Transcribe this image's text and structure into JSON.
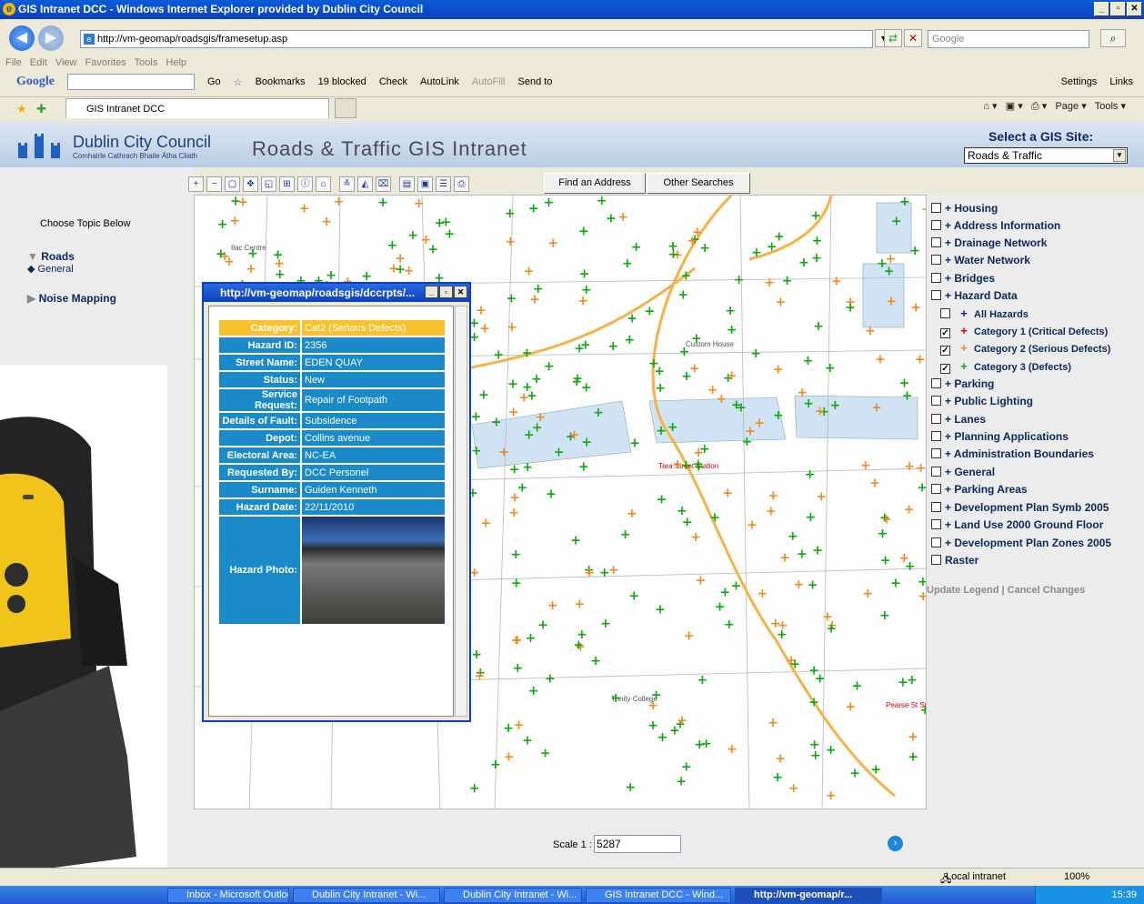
{
  "window": {
    "title": "GIS Intranet DCC - Windows Internet Explorer provided by Dublin City Council",
    "url": "http://vm-geomap/roadsgis/framesetup.asp",
    "search_placeholder": "Google"
  },
  "menu": [
    "File",
    "Edit",
    "View",
    "Favorites",
    "Tools",
    "Help"
  ],
  "google_toolbar": {
    "logo": "Google",
    "go": "Go",
    "bookmarks": "Bookmarks",
    "blocked": "19 blocked",
    "check": "Check",
    "autolink": "AutoLink",
    "autofill": "AutoFill",
    "sendto": "Send to",
    "settings": "Settings",
    "links": "Links"
  },
  "tabs": {
    "active": "GIS Intranet DCC"
  },
  "command_bar": {
    "page": "Page",
    "tools": "Tools"
  },
  "header": {
    "org_name": "Dublin City Council",
    "org_sub": "Comhairle Cathrach Bhaile Átha Cliath",
    "app_title": "Roads & Traffic GIS Intranet",
    "site_label": "Select a GIS Site:",
    "site_value": "Roads & Traffic"
  },
  "toolbar": {
    "find_address": "Find an Address",
    "other_searches": "Other Searches"
  },
  "left": {
    "choose": "Choose Topic Below",
    "roads": "Roads",
    "general": "General",
    "noise": "Noise Mapping"
  },
  "map": {
    "labels": [
      "Ilac Centre",
      "Custom House",
      "Tara Street Station",
      "Trinity College",
      "Pearse St Station"
    ]
  },
  "scale": {
    "label": "Scale 1 :",
    "value": "5287"
  },
  "popup": {
    "title": "http://vm-geomap/roadsgis/dccrpts/...",
    "rows": [
      {
        "k": "Category:",
        "v": "Cat2 (Serious Defects)"
      },
      {
        "k": "Hazard ID:",
        "v": "2356"
      },
      {
        "k": "Street Name:",
        "v": "EDEN QUAY"
      },
      {
        "k": "Status:",
        "v": "New"
      },
      {
        "k": "Service Request:",
        "v": "Repair of Footpath"
      },
      {
        "k": "Details of Fault:",
        "v": "Subsidence"
      },
      {
        "k": "Depot:",
        "v": "Collins avenue"
      },
      {
        "k": "Electoral Area:",
        "v": "NC-EA"
      },
      {
        "k": "Requested By:",
        "v": "DCC Personel"
      },
      {
        "k": "Surname:",
        "v": "Guiden Kenneth"
      },
      {
        "k": "Hazard Date:",
        "v": "22/11/2010"
      }
    ],
    "photo_label": "Hazard Photo:"
  },
  "legend": {
    "items": [
      "+ Housing",
      "+ Address Information",
      "+ Drainage Network",
      "+ Water Network",
      "+ Bridges",
      "+ Hazard Data"
    ],
    "hazards": [
      "All Hazards",
      "Category 1 (Critical Defects)",
      "Category 2 (Serious Defects)",
      "Category 3 (Defects)"
    ],
    "items2": [
      "+ Parking",
      "+ Public Lighting",
      "+ Lanes",
      "+ Planning Applications",
      "+ Administration Boundaries",
      "+ General",
      "+ Parking Areas",
      "+ Development Plan Symb 2005",
      "+ Land Use 2000 Ground Floor",
      "+ Development Plan Zones 2005",
      "Raster"
    ],
    "update": "Update Legend",
    "cancel": "Cancel Changes",
    "sep": "|"
  },
  "colors": {
    "cat1": "#e00000",
    "cat2": "#f28a1e",
    "cat3": "#0fa80f",
    "all": "#1a1aa0"
  },
  "status": {
    "zone": "Local intranet",
    "zoom": "100%"
  },
  "taskbar": [
    "Inbox - Microsoft Outlook",
    "Dublin City Intranet - Wi...",
    "Dublin City Intranet - Wi...",
    "GIS Intranet DCC - Wind...",
    "http://vm-geomap/r..."
  ],
  "clock": "15:39"
}
